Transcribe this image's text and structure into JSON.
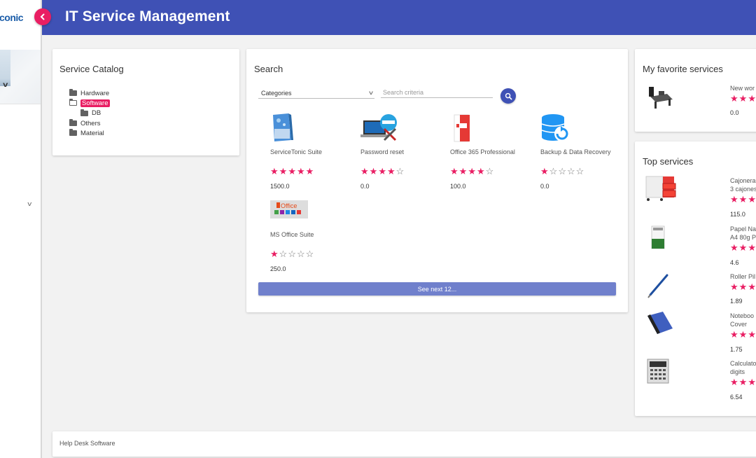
{
  "app": {
    "logo_text": "conic",
    "title": "IT Service Management",
    "brand_color": "#3f51b5",
    "accent_color": "#e91e63"
  },
  "catalog": {
    "title": "Service Catalog",
    "items": [
      {
        "label": "Hardware",
        "level": 0,
        "state": "closed",
        "selected": false
      },
      {
        "label": "Software",
        "level": 0,
        "state": "open",
        "selected": true
      },
      {
        "label": "DB",
        "level": 1,
        "state": "closed",
        "selected": false
      },
      {
        "label": "Others",
        "level": 0,
        "state": "closed",
        "selected": false
      },
      {
        "label": "Material",
        "level": 0,
        "state": "closed",
        "selected": false
      }
    ]
  },
  "search": {
    "title": "Search",
    "category_select": "Categories",
    "criteria_placeholder": "Search criteria",
    "see_next_label": "See next 12...",
    "products": [
      {
        "name": "ServiceTonic Suite",
        "rating": 5,
        "price": "1500.0",
        "icon": "software-box-icon"
      },
      {
        "name": "Password reset",
        "rating": 4,
        "price": "0.0",
        "icon": "laptop-password-icon"
      },
      {
        "name": "Office 365 Professional",
        "rating": 4,
        "price": "100.0",
        "icon": "office365-box-icon"
      },
      {
        "name": "Backup & Data Recovery",
        "rating": 1,
        "price": "0.0",
        "icon": "database-backup-icon"
      },
      {
        "name": "MS Office Suite",
        "rating": 1,
        "price": "250.0",
        "icon": "office-logo-icon"
      }
    ]
  },
  "favorites": {
    "title": "My favorite services",
    "items": [
      {
        "name": "New wor",
        "rating_visible": 3,
        "price": "0.0",
        "icon": "workstation-desk-icon"
      }
    ]
  },
  "top_services": {
    "title": "Top services",
    "items": [
      {
        "name": "Cajonera\n3 cajones",
        "rating_visible": 3,
        "price": "115.0",
        "icon": "drawer-cabinet-icon"
      },
      {
        "name": "Papel Na\nA4 80g P",
        "rating_visible": 3,
        "price": "4.6",
        "icon": "paper-ream-icon"
      },
      {
        "name": "Roller Pil",
        "rating_visible": 3,
        "price": "1.89",
        "icon": "pen-icon"
      },
      {
        "name": "Noteboo\nCover",
        "rating_visible": 3,
        "price": "1.75",
        "icon": "notebook-icon"
      },
      {
        "name": "Calculato\ndigits",
        "rating_visible": 3,
        "price": "6.54",
        "icon": "calculator-icon"
      }
    ]
  },
  "footer": {
    "text": "Help Desk Software"
  }
}
